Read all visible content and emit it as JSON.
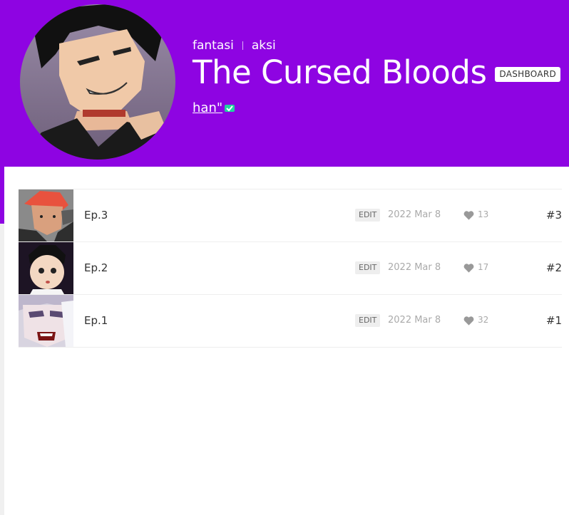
{
  "colors": {
    "accent": "#8e04e2"
  },
  "series": {
    "genres": [
      "fantasi",
      "aksi"
    ],
    "title": "The Cursed Bloods",
    "dashboard_label": "DASHBOARD",
    "author": "han\""
  },
  "episodes": [
    {
      "title": "Ep.3",
      "edit_label": "EDIT",
      "date": "2022 Mar 8",
      "likes": "13",
      "number": "#3"
    },
    {
      "title": "Ep.2",
      "edit_label": "EDIT",
      "date": "2022 Mar 8",
      "likes": "17",
      "number": "#2"
    },
    {
      "title": "Ep.1",
      "edit_label": "EDIT",
      "date": "2022 Mar 8",
      "likes": "32",
      "number": "#1"
    }
  ]
}
